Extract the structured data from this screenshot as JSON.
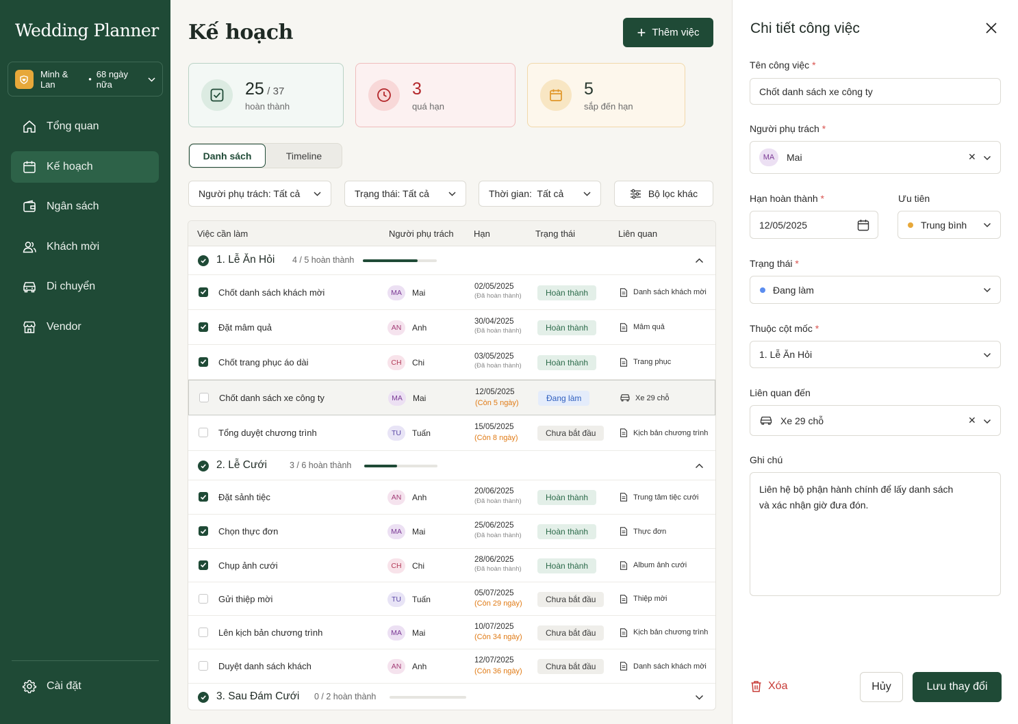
{
  "sidebar": {
    "brand": "Wedding Planner",
    "couple": "Minh & Lan",
    "countdown": "68 ngày nữa",
    "items": [
      {
        "label": "Tổng quan",
        "icon": "home-icon"
      },
      {
        "label": "Kế hoạch",
        "icon": "calendar-icon"
      },
      {
        "label": "Ngân sách",
        "icon": "wallet-icon"
      },
      {
        "label": "Khách mời",
        "icon": "users-icon"
      },
      {
        "label": "Di chuyển",
        "icon": "car-icon"
      },
      {
        "label": "Vendor",
        "icon": "store-icon"
      }
    ],
    "settings": "Cài đặt"
  },
  "header": {
    "title": "Kế hoạch",
    "add_button": "Thêm việc"
  },
  "stats": [
    {
      "value": "25",
      "total": "/ 37",
      "label": "hoàn thành"
    },
    {
      "value": "3",
      "label": "quá hạn"
    },
    {
      "value": "5",
      "label": "sắp đến hạn"
    }
  ],
  "views": {
    "list": "Danh sách",
    "timeline": "Timeline"
  },
  "filters": {
    "owner": "Người phụ trách: Tất cả",
    "status": "Trạng thái: Tất cả",
    "time": "Thời gian:  Tất cả",
    "more": "Bộ lọc khác"
  },
  "table": {
    "columns": [
      "Việc cần làm",
      "Người phụ trách",
      "Hạn",
      "Trạng thái",
      "Liên quan"
    ],
    "groups": [
      {
        "name": "1. Lễ Ăn Hỏi",
        "count": "4 / 5 hoàn thành",
        "progress": 0.74,
        "expanded": true,
        "tasks": [
          {
            "name": "Chốt danh sách khách mời",
            "done": true,
            "av": "MA",
            "person": "Mai",
            "date": "02/05/2025",
            "note": "(Đã hoàn thành)",
            "status": "Hoàn thành",
            "rel": "Danh sách khách mời"
          },
          {
            "name": "Đặt mâm quả",
            "done": true,
            "av": "AN",
            "person": "Anh",
            "date": "30/04/2025",
            "note": "(Đã hoàn thành)",
            "status": "Hoàn thành",
            "rel": "Mâm quả"
          },
          {
            "name": "Chốt trang phục áo dài",
            "done": true,
            "av": "CH",
            "person": "Chi",
            "date": "03/05/2025",
            "note": "(Đã hoàn thành)",
            "status": "Hoàn thành",
            "rel": "Trang phục"
          },
          {
            "name": "Chốt danh sách xe công ty",
            "done": false,
            "av": "MA",
            "person": "Mai",
            "date": "12/05/2025",
            "note": "(Còn 5 ngày)",
            "status": "Đang làm",
            "rel": "Xe 29 chỗ"
          },
          {
            "name": "Tổng duyệt chương trình",
            "done": false,
            "av": "TU",
            "person": "Tuấn",
            "date": "15/05/2025",
            "note": "(Còn 8 ngày)",
            "status": "Chưa bắt đầu",
            "rel": "Kịch bản chương trình"
          }
        ]
      },
      {
        "name": "2. Lễ Cưới",
        "count": "3 / 6 hoàn thành",
        "progress": 0.45,
        "expanded": true,
        "tasks": [
          {
            "name": "Đặt sảnh tiệc",
            "done": true,
            "av": "AN",
            "person": "Anh",
            "date": "20/06/2025",
            "note": "(Đã hoàn thành)",
            "status": "Hoàn thành",
            "rel": "Trung tâm tiệc cưới"
          },
          {
            "name": "Chọn thực đơn",
            "done": true,
            "av": "MA",
            "person": "Mai",
            "date": "25/06/2025",
            "note": "(Đã hoàn thành)",
            "status": "Hoàn thành",
            "rel": "Thực đơn"
          },
          {
            "name": "Chụp ảnh cưới",
            "done": true,
            "av": "CH",
            "person": "Chi",
            "date": "28/06/2025",
            "note": "(Đã hoàn thành)",
            "status": "Hoàn thành",
            "rel": "Album ảnh cưới"
          },
          {
            "name": "Gửi thiệp mời",
            "done": false,
            "av": "TU",
            "person": "Tuấn",
            "date": "05/07/2025",
            "note": "(Còn 29 ngày)",
            "status": "Chưa bắt đầu",
            "rel": "Thiệp mời"
          },
          {
            "name": "Lên kịch bản chương trình",
            "done": false,
            "av": "MA",
            "person": "Mai",
            "date": "10/07/2025",
            "note": "(Còn 34 ngày)",
            "status": "Chưa bắt đầu",
            "rel": "Kịch bản chương trình"
          },
          {
            "name": "Duyệt danh sách khách",
            "done": false,
            "av": "AN",
            "person": "Anh",
            "date": "12/07/2025",
            "note": "(Còn 36 ngày)",
            "status": "Chưa bắt đầu",
            "rel": "Danh sách khách mời"
          }
        ]
      },
      {
        "name": "3. Sau Đám Cưới",
        "count": "0 / 2 hoàn thành",
        "progress": 0,
        "expanded": false,
        "tasks": []
      }
    ]
  },
  "panel": {
    "title": "Chi tiết công việc",
    "name_label": "Tên công việc",
    "name_value": "Chốt danh sách xe công ty",
    "owner_label": "Người phụ trách",
    "owner_avatar": "MA",
    "owner_value": "Mai",
    "due_label": "Hạn hoàn thành",
    "due_value": "12/05/2025",
    "priority_label": "Ưu tiên",
    "priority_value": "Trung bình",
    "status_label": "Trạng thái",
    "status_value": "Đang làm",
    "milestone_label": "Thuộc cột mốc",
    "milestone_value": "1. Lễ Ăn Hỏi",
    "related_label": "Liên quan đến",
    "related_value": "Xe 29 chỗ",
    "note_label": "Ghi chú",
    "note_value": "Liên hệ bộ phận hành chính để lấy danh sách\nvà xác nhận giờ đưa đón.",
    "delete": "Xóa",
    "cancel": "Hủy",
    "save": "Lưu thay đổi"
  },
  "colors": {
    "primary": "#1f4a36",
    "overdue": "#b3262a",
    "warn": "#e07a14",
    "doing": "#2f5fbf",
    "priority_dot": "#e7a83a",
    "status_dot": "#5b8def"
  }
}
